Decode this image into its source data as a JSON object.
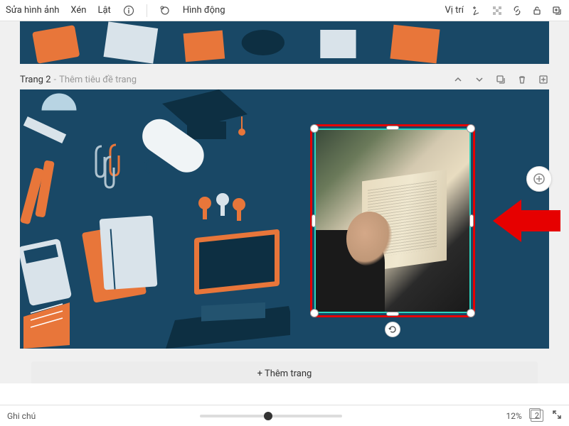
{
  "toolbar": {
    "edit_image": "Sửa hình ảnh",
    "crop": "Xén",
    "flip": "Lật",
    "animate": "Hình động",
    "position": "Vị trí"
  },
  "page": {
    "label": "Trang 2",
    "title_hint": "Thêm tiêu đề trang"
  },
  "actions": {
    "add_page": "+ Thêm trang"
  },
  "bottom": {
    "notes": "Ghi chú",
    "zoom": "12%",
    "page_num": "2"
  },
  "colors": {
    "canvas_bg": "#194866",
    "accent_orange": "#e8763a",
    "accent_teal": "#2dd4bf",
    "annotation_red": "#e60000"
  }
}
